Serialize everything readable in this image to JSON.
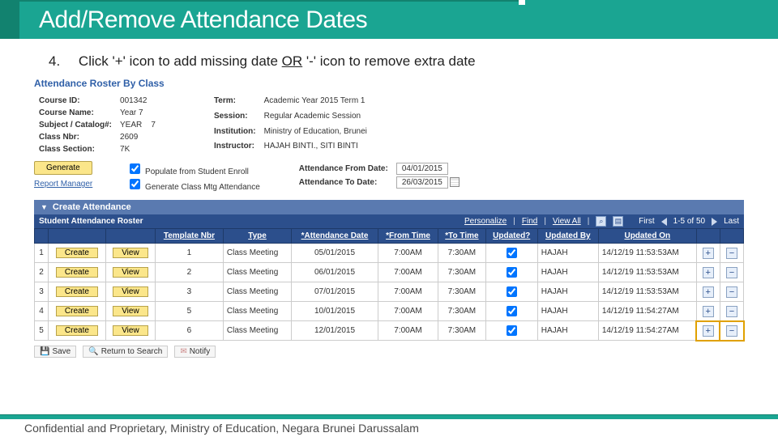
{
  "title": "Add/Remove Attendance Dates",
  "step": {
    "num": "4.",
    "text_a": "Click '+' icon to add missing date ",
    "or": "OR",
    "text_b": " '-' icon to remove extra date"
  },
  "roster_title": "Attendance Roster By Class",
  "left_fields": {
    "course_id_l": "Course ID:",
    "course_id_v": "001342",
    "course_name_l": "Course Name:",
    "course_name_v": "Year 7",
    "subj_l": "Subject / Catalog#:",
    "subj_v1": "YEAR",
    "subj_v2": "7",
    "class_nbr_l": "Class Nbr:",
    "class_nbr_v": "2609",
    "class_sec_l": "Class Section:",
    "class_sec_v": "7K"
  },
  "right_fields": {
    "term_l": "Term:",
    "term_v": "Academic Year 2015 Term 1",
    "session_l": "Session:",
    "session_v": "Regular Academic Session",
    "inst_l": "Institution:",
    "inst_v": "Ministry of Education, Brunei",
    "instr_l": "Instructor:",
    "instr_v": "HAJAH BINTI., SITI BINTI"
  },
  "generate_btn": "Generate",
  "chk1": "Populate from Student Enroll",
  "chk2": "Generate Class Mtg Attendance",
  "att_from_l": "Attendance From Date:",
  "att_from_v": "04/01/2015",
  "att_to_l": "Attendance To Date:",
  "att_to_v": "26/03/2015",
  "report_mgr": "Report Manager",
  "create_att": "Create Attendance",
  "sar_title": "Student Attendance Roster",
  "sar_links": {
    "personalize": "Personalize",
    "find": "Find",
    "viewall": "View All"
  },
  "pager": {
    "first": "First",
    "range": "1-5 of 50",
    "last": "Last"
  },
  "cols": {
    "template": "Template Nbr",
    "type": "Type",
    "attdate": "*Attendance Date",
    "from": "*From Time",
    "to": "*To Time",
    "updatedq": "Updated?",
    "updatedby": "Updated By",
    "updatedon": "Updated On"
  },
  "btns": {
    "create": "Create",
    "view": "View"
  },
  "rows": [
    {
      "i": "1",
      "t": "1",
      "type": "Class Meeting",
      "d": "05/01/2015",
      "f": "7:00AM",
      "to": "7:30AM",
      "by": "HAJAH",
      "on": "14/12/19 11:53:53AM"
    },
    {
      "i": "2",
      "t": "2",
      "type": "Class Meeting",
      "d": "06/01/2015",
      "f": "7:00AM",
      "to": "7:30AM",
      "by": "HAJAH",
      "on": "14/12/19 11:53:53AM"
    },
    {
      "i": "3",
      "t": "3",
      "type": "Class Meeting",
      "d": "07/01/2015",
      "f": "7:00AM",
      "to": "7:30AM",
      "by": "HAJAH",
      "on": "14/12/19 11:53:53AM"
    },
    {
      "i": "4",
      "t": "5",
      "type": "Class Meeting",
      "d": "10/01/2015",
      "f": "7:00AM",
      "to": "7:30AM",
      "by": "HAJAH",
      "on": "14/12/19 11:54:27AM"
    },
    {
      "i": "5",
      "t": "6",
      "type": "Class Meeting",
      "d": "12/01/2015",
      "f": "7:00AM",
      "to": "7:30AM",
      "by": "HAJAH",
      "on": "14/12/19 11:54:27AM"
    }
  ],
  "footer_actions": {
    "save": "Save",
    "return": "Return to Search",
    "notify": "Notify"
  },
  "footer_text": "Confidential and Proprietary, Ministry of Education, Negara Brunei Darussalam"
}
